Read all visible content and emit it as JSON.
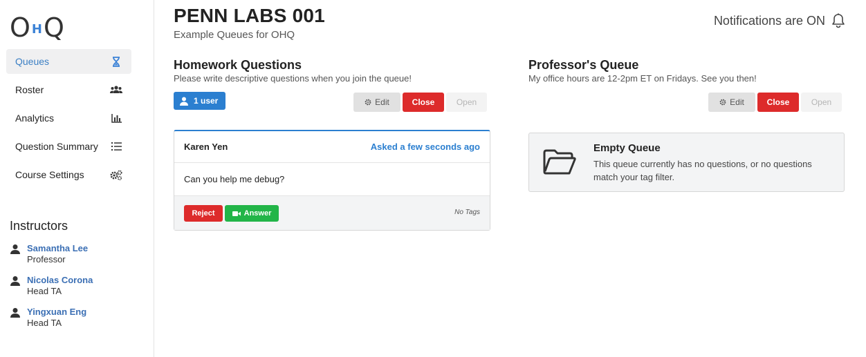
{
  "logo": {
    "o": "O",
    "h": "H",
    "q": "Q"
  },
  "sidebar": {
    "items": [
      {
        "label": "Queues",
        "icon": "hourglass-icon",
        "active": true
      },
      {
        "label": "Roster",
        "icon": "users-icon",
        "active": false
      },
      {
        "label": "Analytics",
        "icon": "bar-chart-icon",
        "active": false
      },
      {
        "label": "Question Summary",
        "icon": "ordered-list-icon",
        "active": false
      },
      {
        "label": "Course Settings",
        "icon": "cogs-icon",
        "active": false
      }
    ],
    "instructors_title": "Instructors",
    "instructors": [
      {
        "name": "Samantha Lee",
        "role": "Professor"
      },
      {
        "name": "Nicolas Corona",
        "role": "Head TA"
      },
      {
        "name": "Yingxuan Eng",
        "role": "Head TA"
      }
    ]
  },
  "header": {
    "course_title": "PENN LABS 001",
    "course_subtitle": "Example Queues for OHQ",
    "notifications": "Notifications are ON"
  },
  "queues": [
    {
      "title": "Homework Questions",
      "description": "Please write descriptive questions when you join the queue!",
      "users_badge": "1 user",
      "edit_label": "Edit",
      "close_label": "Close",
      "open_label": "Open",
      "question": {
        "asker": "Karen Yen",
        "time": "Asked a few seconds ago",
        "text": "Can you help me debug?",
        "reject_label": "Reject",
        "answer_label": "Answer",
        "tags": "No Tags"
      }
    },
    {
      "title": "Professor's Queue",
      "description": "My office hours are 12-2pm ET on Fridays. See you then!",
      "edit_label": "Edit",
      "close_label": "Close",
      "open_label": "Open",
      "empty": {
        "title": "Empty Queue",
        "text": "This queue currently has no questions, or no questions match your tag filter."
      }
    }
  ],
  "colors": {
    "primary": "#2b7fd0",
    "danger": "#dd2b2b",
    "success": "#22b548",
    "link": "#3b6fb4"
  }
}
